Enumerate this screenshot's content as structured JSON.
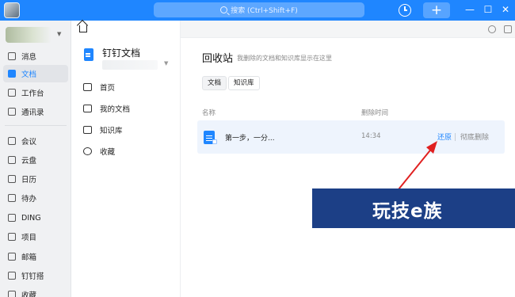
{
  "titlebar": {
    "search_placeholder": "搜索 (Ctrl+Shift+F)",
    "plus_label": "+",
    "minimize_label": "—",
    "maximize_label": "☐",
    "close_label": "✕",
    "accent_color": "#1f86ff"
  },
  "nav": {
    "items": [
      {
        "label": "消息",
        "icon": "message-icon"
      },
      {
        "label": "文档",
        "icon": "document-icon",
        "active": true
      },
      {
        "label": "工作台",
        "icon": "grid-icon"
      },
      {
        "label": "通讯录",
        "icon": "contacts-icon"
      },
      {
        "label": "会议",
        "icon": "video-icon"
      },
      {
        "label": "云盘",
        "icon": "cloud-icon"
      },
      {
        "label": "日历",
        "icon": "calendar-icon"
      },
      {
        "label": "待办",
        "icon": "todo-icon"
      },
      {
        "label": "DING",
        "icon": "ding-icon"
      },
      {
        "label": "项目",
        "icon": "project-icon"
      },
      {
        "label": "邮箱",
        "icon": "mail-icon"
      },
      {
        "label": "钉钉搭",
        "icon": "builder-icon"
      },
      {
        "label": "收藏",
        "icon": "favorite-icon"
      }
    ]
  },
  "sidebar": {
    "title": "钉钉文档",
    "items": [
      {
        "label": "首页",
        "icon": "home-icon"
      },
      {
        "label": "我的文档",
        "icon": "folder-icon"
      },
      {
        "label": "知识库",
        "icon": "book-icon"
      },
      {
        "label": "收藏",
        "icon": "star-icon"
      }
    ]
  },
  "main": {
    "title": "回收站",
    "hint": "我删除的文档和知识库显示在这里",
    "tabs": [
      {
        "label": "文档",
        "active": true
      },
      {
        "label": "知识库",
        "active": false
      }
    ],
    "columns": {
      "name": "名称",
      "time": "删除时间"
    },
    "rows": [
      {
        "name": "第一步，一分...",
        "time": "14:34",
        "restore": "还原",
        "purge": "彻底删除"
      }
    ]
  },
  "watermark": {
    "text": "玩技e族"
  }
}
